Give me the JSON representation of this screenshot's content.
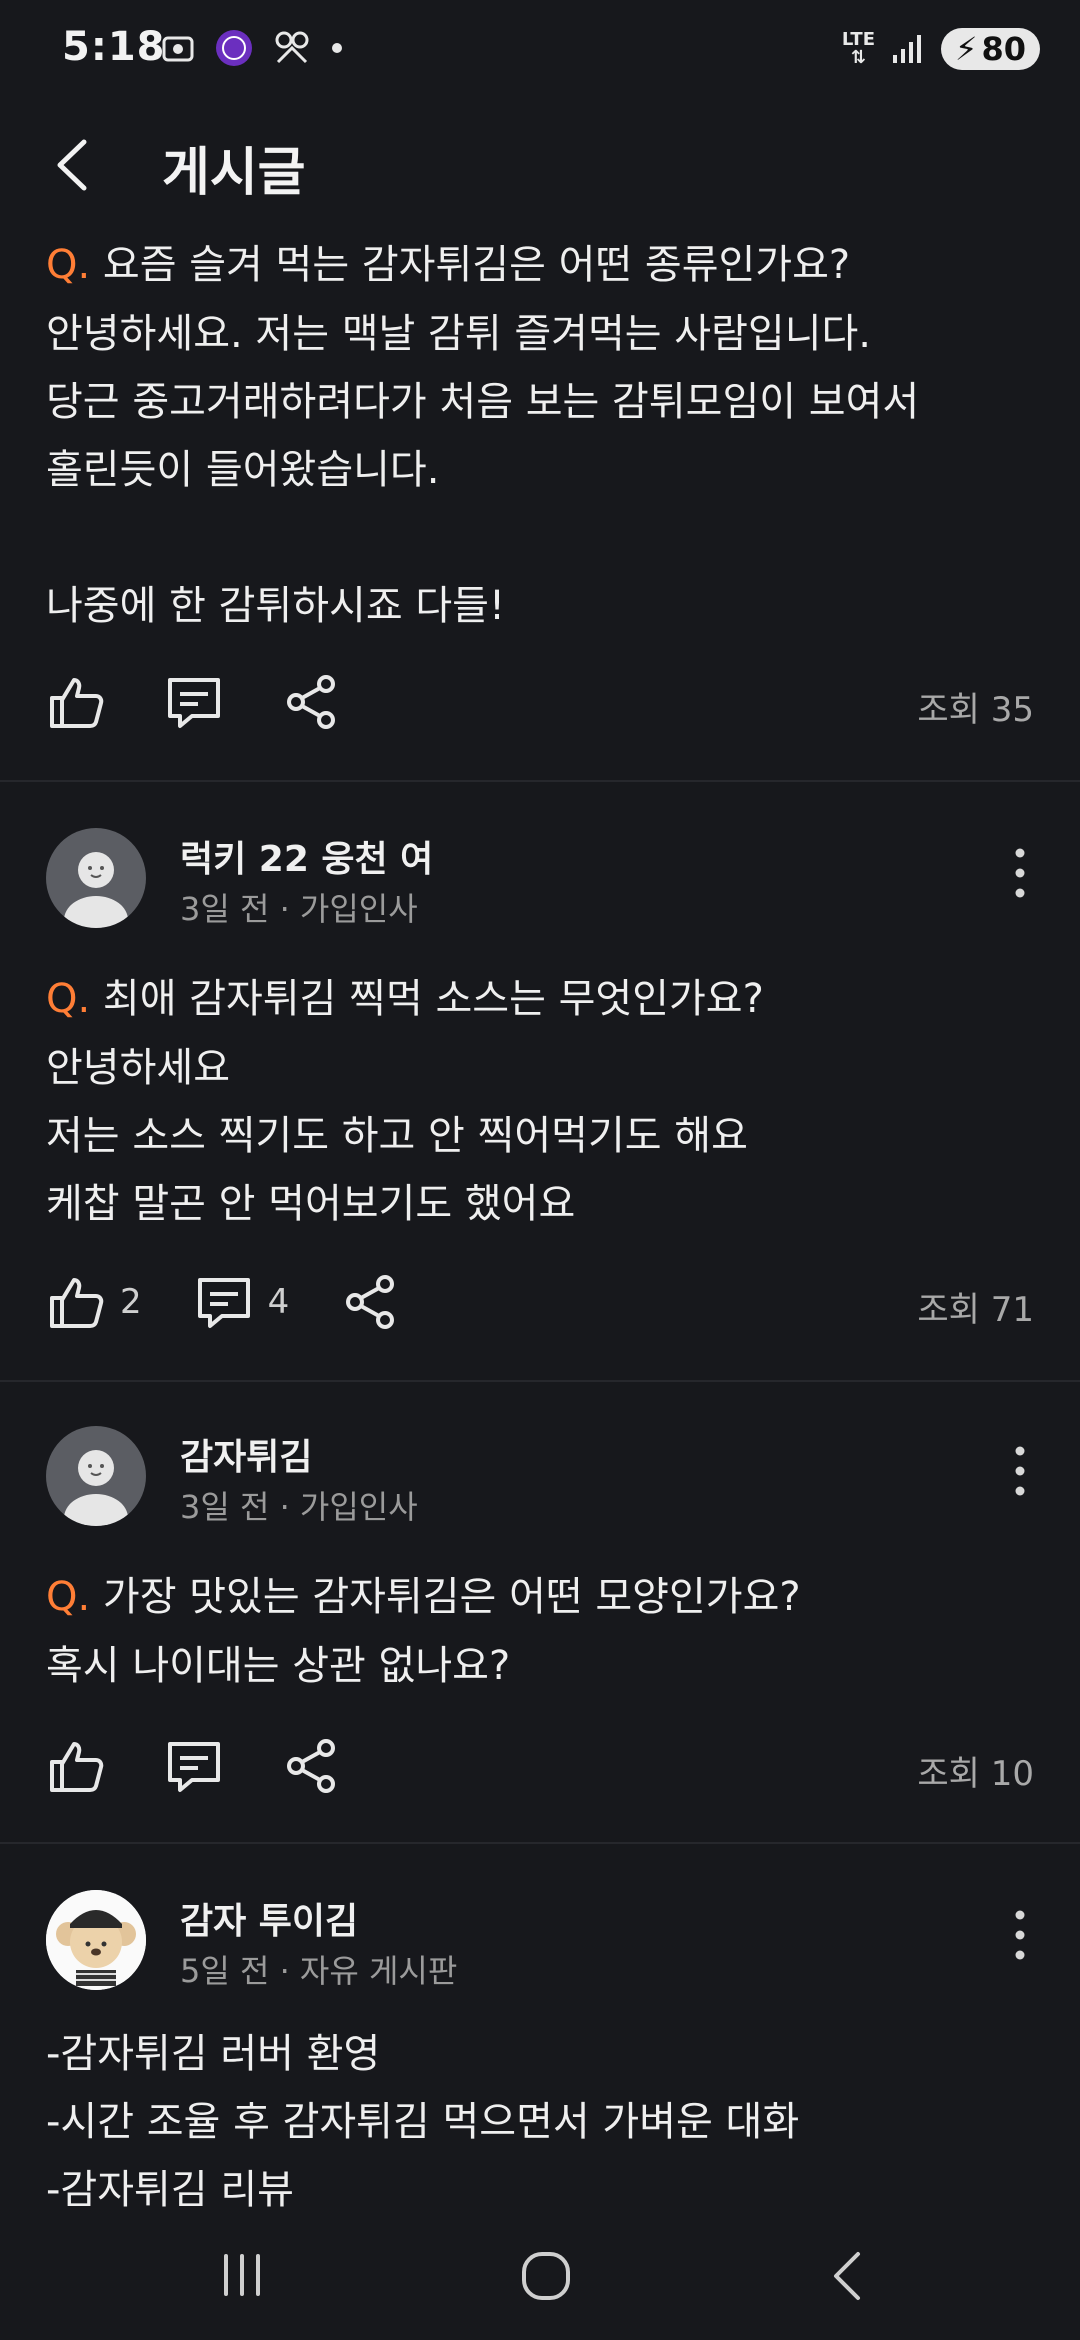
{
  "status": {
    "time": "5:18",
    "network": "LTE",
    "battery": "80"
  },
  "header": {
    "title": "게시글"
  },
  "q_prefix": "Q.",
  "posts": [
    {
      "question": "요즘 슬겨 먹는 감자튀김은 어떤 종류인가요?",
      "body": "안녕하세요. 저는 맥날 감튀 즐겨먹는 사람입니다.\n당근 중고거래하려다가 처음 보는 감튀모임이 보여서\n홀린듯이 들어왔습니다.\n\n나중에 한 감튀하시죠 다들!",
      "views": "조회 35"
    },
    {
      "author": "럭키 22 웅천 여",
      "meta": "3일 전 · 가입인사",
      "question": "최애 감자튀김 찍먹 소스는 무엇인가요?",
      "body": "안녕하세요\n저는 소스 찍기도 하고 안 찍어먹기도 해요\n케찹 말곤 안 먹어보기도 했어요",
      "likes": "2",
      "comments": "4",
      "views": "조회 71"
    },
    {
      "author": "감자튀김",
      "meta": "3일 전 · 가입인사",
      "question": "가장 맛있는 감자튀김은 어떤 모양인가요?",
      "body": "혹시 나이대는 상관 없나요?",
      "views": "조회 10"
    },
    {
      "author": "감자 투이김",
      "meta": "5일 전 · 자유 게시판",
      "body": "-감자튀김 러버 환영\n-시간 조율 후 감자튀김 먹으면서 가벼운 대화\n-감자튀김 리뷰"
    }
  ],
  "colors": {
    "accent": "#ff7e36",
    "background": "#17181c"
  }
}
